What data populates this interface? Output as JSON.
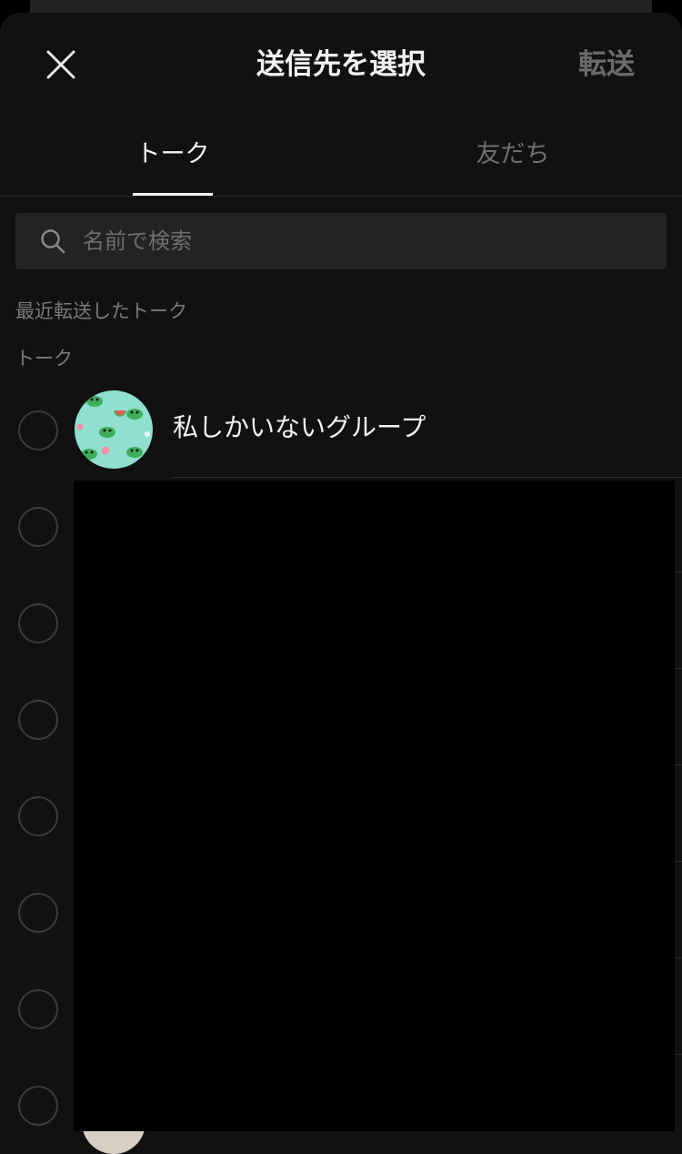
{
  "header": {
    "title": "送信先を選択",
    "forward_label": "転送"
  },
  "tabs": [
    {
      "label": "トーク",
      "active": true
    },
    {
      "label": "友だち",
      "active": false
    }
  ],
  "search": {
    "placeholder": "名前で検索",
    "value": ""
  },
  "sections": {
    "recent_label": "最近転送したトーク",
    "talk_label": "トーク"
  },
  "talks": [
    {
      "name": "私しかいないグループ",
      "avatar": "frog-pattern-avatar",
      "selected": false
    }
  ],
  "colors": {
    "background": "#111111",
    "text_primary": "#f2f2f2",
    "text_muted": "#6e6e6e",
    "avatar_bg": "#8fe0cf"
  }
}
